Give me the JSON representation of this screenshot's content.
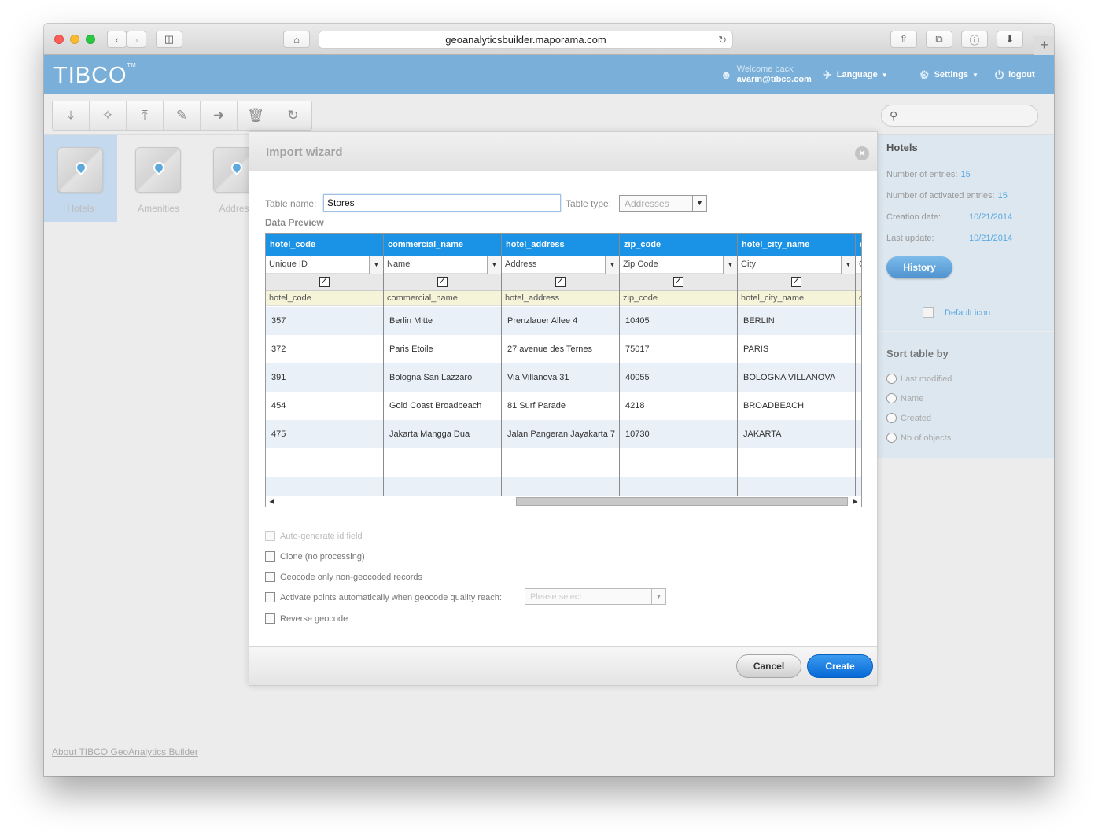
{
  "browser": {
    "url": "geoanalyticsbuilder.maporama.com"
  },
  "app": {
    "logo": "TIBCO",
    "welcome_label": "Welcome back",
    "user_email": "avarin@tibco.com",
    "language_label": "Language",
    "settings_label": "Settings",
    "logout_label": "logout",
    "accent_color": "#79afd9"
  },
  "toolbar": {
    "tools": [
      "download-icon",
      "magic-wand-icon",
      "upload-icon",
      "pencil-icon",
      "export-icon",
      "trash-icon",
      "refresh-icon"
    ]
  },
  "layers": [
    {
      "name": "Hotels",
      "selected": true
    },
    {
      "name": "Amenities",
      "selected": false
    },
    {
      "name": "Address",
      "selected": false
    }
  ],
  "footer": {
    "about_link": "About TIBCO GeoAnalytics Builder"
  },
  "right_panel": {
    "title": "Hotels",
    "entries_label": "Number of entries:",
    "entries_value": "15",
    "activated_label": "Number of activated entries:",
    "activated_value": "15",
    "creation_label": "Creation date:",
    "creation_value": "10/21/2014",
    "update_label": "Last update:",
    "update_value": "10/21/2014",
    "history_button": "History",
    "default_icon_link": "Default icon",
    "sort_title": "Sort table by",
    "sort_options": [
      "Last modified",
      "Name",
      "Created",
      "Nb of objects"
    ]
  },
  "modal": {
    "title": "Import wizard",
    "table_name_label": "Table name:",
    "table_name_value": "Stores",
    "table_type_label": "Table type:",
    "table_type_value": "Addresses",
    "data_preview_label": "Data Preview",
    "columns": [
      {
        "header": "hotel_code",
        "type": "Unique ID",
        "source": "hotel_code"
      },
      {
        "header": "commercial_name",
        "type": "Name",
        "source": "commercial_name"
      },
      {
        "header": "hotel_address",
        "type": "Address",
        "source": "hotel_address"
      },
      {
        "header": "zip_code",
        "type": "Zip Code",
        "source": "zip_code"
      },
      {
        "header": "hotel_city_name",
        "type": "City",
        "source": "hotel_city_name"
      },
      {
        "header": "c",
        "type": "C",
        "source": "c"
      }
    ],
    "rows": [
      [
        "357",
        "Berlin Mitte",
        "Prenzlauer Allee 4",
        "10405",
        "BERLIN",
        ""
      ],
      [
        "372",
        "Paris Etoile",
        "27 avenue des Ternes",
        "75017",
        "PARIS",
        ""
      ],
      [
        "391",
        "Bologna San Lazzaro",
        "Via Villanova 31",
        "40055",
        "BOLOGNA VILLANOVA",
        ""
      ],
      [
        "454",
        "Gold Coast Broadbeach",
        "81 Surf Parade",
        "4218",
        "BROADBEACH",
        ""
      ],
      [
        "475",
        "Jakarta Mangga Dua",
        "Jalan Pangeran Jayakarta  7",
        "10730",
        "JAKARTA",
        ""
      ]
    ],
    "options": {
      "auto_generate": "Auto-generate id field",
      "clone": "Clone (no processing)",
      "geocode_only": "Geocode only non-geocoded records",
      "activate_points": "Activate points automatically when geocode quality reach:",
      "quality_placeholder": "Please select",
      "reverse_geocode": "Reverse geocode"
    },
    "cancel_button": "Cancel",
    "create_button": "Create"
  }
}
